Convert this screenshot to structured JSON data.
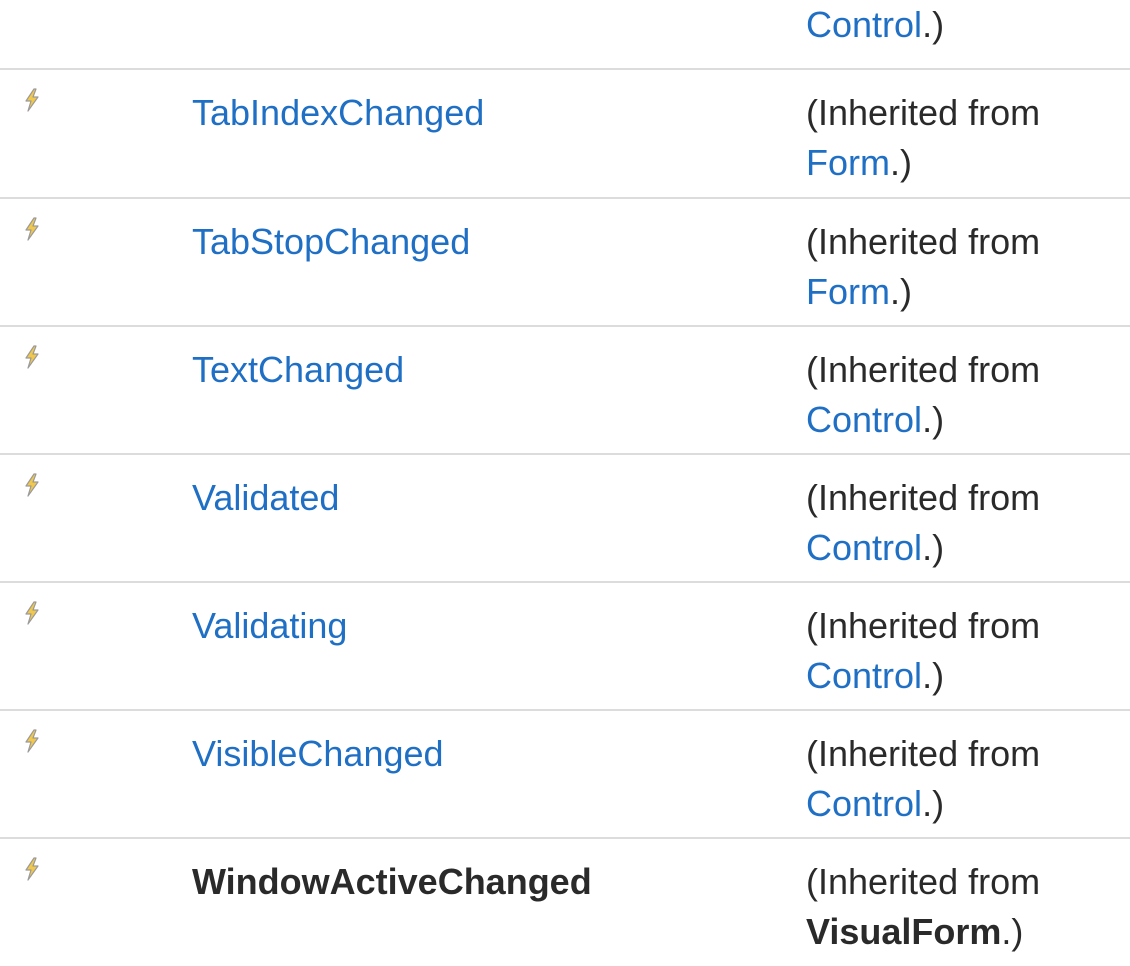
{
  "top_row": {
    "link": "Control",
    "suffix": ".)"
  },
  "rows": [
    {
      "icon": "event-lightning-icon",
      "name": "TabIndexChanged",
      "inherited_prefix": "(Inherited from",
      "inherited_from": "Form",
      "suffix": ".)"
    },
    {
      "icon": "event-lightning-icon",
      "name": "TabStopChanged",
      "inherited_prefix": "(Inherited from",
      "inherited_from": "Form",
      "suffix": ".)"
    },
    {
      "icon": "event-lightning-icon",
      "name": "TextChanged",
      "inherited_prefix": "(Inherited from",
      "inherited_from": "Control",
      "suffix": ".)"
    },
    {
      "icon": "event-lightning-icon",
      "name": "Validated",
      "inherited_prefix": "(Inherited from",
      "inherited_from": "Control",
      "suffix": ".)"
    },
    {
      "icon": "event-lightning-icon",
      "name": "Validating",
      "inherited_prefix": "(Inherited from",
      "inherited_from": "Control",
      "suffix": ".)"
    },
    {
      "icon": "event-lightning-icon",
      "name": "VisibleChanged",
      "inherited_prefix": "(Inherited from",
      "inherited_from": "Control",
      "suffix": ".)"
    },
    {
      "icon": "event-lightning-icon",
      "name": "WindowActiveChanged",
      "inherited_prefix": "(Inherited from",
      "inherited_from": "VisualForm",
      "suffix": ".)"
    }
  ],
  "colors": {
    "link": "#1f6fc5",
    "text": "#2a2a2a",
    "separator": "#dcdcdc",
    "icon_fill": "#f2c84b",
    "icon_stroke": "#9a9a9a"
  }
}
